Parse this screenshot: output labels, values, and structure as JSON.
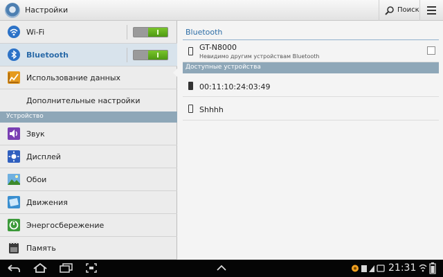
{
  "header": {
    "title": "Настройки",
    "search_label": "Поиск",
    "app_icon": "settings-gear-icon"
  },
  "sidebar": {
    "section_device": "Устройство",
    "items": [
      {
        "label": "Wi-Fi",
        "icon": "wifi-icon",
        "toggle": true
      },
      {
        "label": "Bluetooth",
        "icon": "bluetooth-icon",
        "toggle": true,
        "selected": true
      },
      {
        "label": "Использование данных",
        "icon": "data-usage-icon"
      },
      {
        "label": "Дополнительные настройки",
        "icon": ""
      },
      {
        "label": "Звук",
        "icon": "sound-icon"
      },
      {
        "label": "Дисплей",
        "icon": "display-icon"
      },
      {
        "label": "Обои",
        "icon": "wallpaper-icon"
      },
      {
        "label": "Движения",
        "icon": "motion-icon"
      },
      {
        "label": "Энергосбережение",
        "icon": "power-saving-icon"
      },
      {
        "label": "Память",
        "icon": "storage-icon"
      }
    ]
  },
  "main": {
    "title": "Bluetooth",
    "this_device": {
      "name": "GT-N8000",
      "status": "Невидимо другим устройствам Bluetooth",
      "visible_checked": false
    },
    "available_header": "Доступные устройства",
    "devices": [
      {
        "name": "00:11:10:24:03:49",
        "icon": "device-icon"
      },
      {
        "name": "Shhhh",
        "icon": "phone-icon"
      }
    ]
  },
  "system_bar": {
    "time": "21:31"
  },
  "colors": {
    "accent": "#2d6da6",
    "toggle_on": "#5fae1b",
    "section": "#8ea7b8"
  }
}
